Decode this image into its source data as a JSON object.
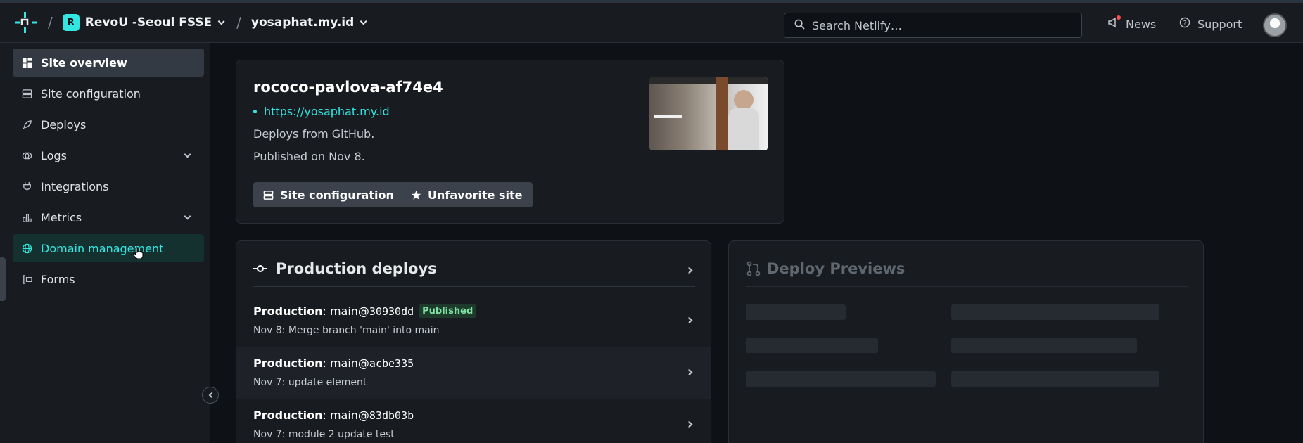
{
  "topbar": {
    "team_initial": "R",
    "team_name": "RevoU -Seoul FSSE",
    "site_name": "yosaphat.my.id",
    "breadcrumb_separator": "/",
    "search_placeholder": "Search Netlify…",
    "news_label": "News",
    "support_label": "Support"
  },
  "sidebar": {
    "items": [
      {
        "label": "Site overview",
        "icon": "grid-icon",
        "active": true
      },
      {
        "label": "Site configuration",
        "icon": "config-icon"
      },
      {
        "label": "Deploys",
        "icon": "rocket-icon"
      },
      {
        "label": "Logs",
        "icon": "logs-icon",
        "expandable": true
      },
      {
        "label": "Integrations",
        "icon": "plug-icon"
      },
      {
        "label": "Metrics",
        "icon": "chart-icon",
        "expandable": true
      },
      {
        "label": "Domain management",
        "icon": "globe-icon",
        "hover": true
      },
      {
        "label": "Forms",
        "icon": "form-icon"
      }
    ]
  },
  "site_card": {
    "title": "rococo-pavlova-af74e4",
    "url": "https://yosaphat.my.id",
    "deploys_from": "Deploys from GitHub.",
    "published": "Published on Nov 8.",
    "config_button": "Site configuration",
    "favorite_button": "Unfavorite site"
  },
  "production_deploys": {
    "heading": "Production deploys",
    "rows": [
      {
        "label": "Production",
        "branch": "main@",
        "commit": "30930dd",
        "badge": "Published",
        "subtitle": "Nov 8: Merge branch 'main' into main"
      },
      {
        "label": "Production",
        "branch": "main@",
        "commit": "acbe335",
        "subtitle": "Nov 7: update element"
      },
      {
        "label": "Production",
        "branch": "main@",
        "commit": "83db03b",
        "subtitle": "Nov 7: module 2 update test"
      }
    ]
  },
  "deploy_previews": {
    "heading": "Deploy Previews"
  },
  "colors": {
    "accent": "#32e6e2",
    "background": "#0e1217",
    "surface": "#181b20",
    "published_badge": "#7fe0a3"
  }
}
